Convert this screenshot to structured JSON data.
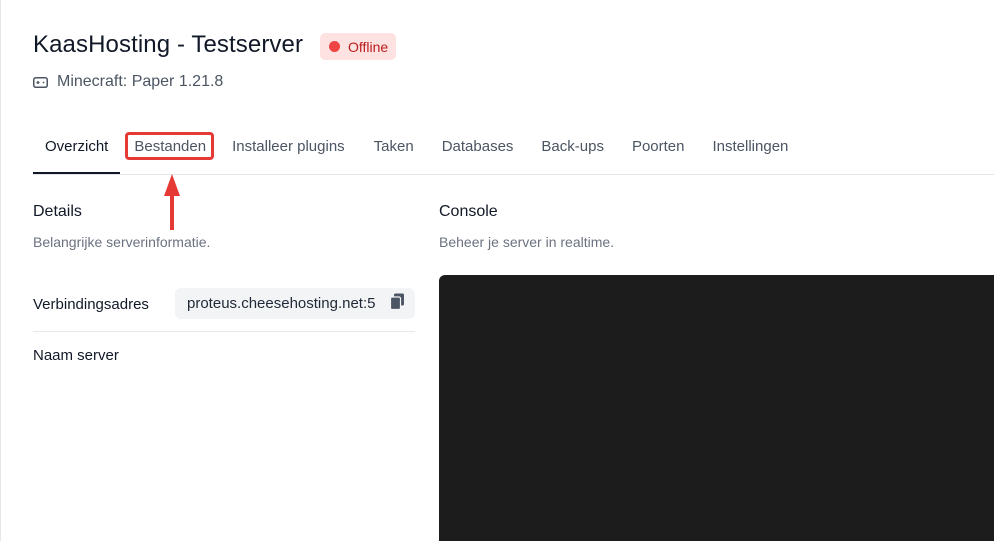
{
  "header": {
    "title": "KaasHosting - Testserver",
    "status_label": "Offline",
    "status_color": "#ef4444",
    "game_icon": "gamepad-icon",
    "game_info": "Minecraft: Paper 1.21.8"
  },
  "tabs": [
    {
      "label": "Overzicht",
      "active": true
    },
    {
      "label": "Bestanden",
      "active": false,
      "highlighted": true
    },
    {
      "label": "Installeer plugins",
      "active": false
    },
    {
      "label": "Taken",
      "active": false
    },
    {
      "label": "Databases",
      "active": false
    },
    {
      "label": "Back-ups",
      "active": false
    },
    {
      "label": "Poorten",
      "active": false
    },
    {
      "label": "Instellingen",
      "active": false
    }
  ],
  "details": {
    "title": "Details",
    "description": "Belangrijke serverinformatie.",
    "connection_label": "Verbindingsadres",
    "connection_value": "proteus.cheesehosting.net:5",
    "copy_icon": "copy-icon",
    "server_name_label": "Naam server"
  },
  "console": {
    "title": "Console",
    "description": "Beheer je server in realtime."
  },
  "annotation": {
    "highlight_color": "#e53935"
  }
}
